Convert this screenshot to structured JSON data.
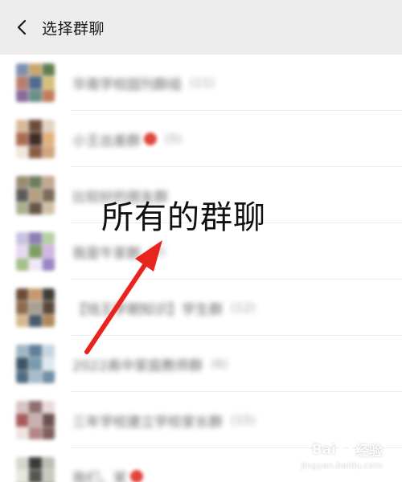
{
  "header": {
    "title": "选择群聊",
    "back_icon": "chevron-left-icon",
    "background": "#ededed"
  },
  "groups": [
    {
      "name": "华南学校园刊群组",
      "count": "(11)",
      "avatar_colors": [
        "#7a8fb0",
        "#c9a66b",
        "#5e7d4f",
        "#b77d6d",
        "#4f6a8c",
        "#d8c07a",
        "#8a6a9c",
        "#6b8f86",
        "#c47c5a"
      ]
    },
    {
      "name": "小王出差群",
      "count": "(5)",
      "emoji": true,
      "avatar_colors": [
        "#d8b99a",
        "#6e4a3a",
        "#e2d2c2",
        "#aa6b50",
        "#3f2c25",
        "#e4b07a",
        "#f0e6dc",
        "#8b5c44",
        "#d1a47c"
      ]
    },
    {
      "name": "比较好的朋友群",
      "count": "",
      "avatar_colors": [
        "#9a8a6e",
        "#6f7d5e",
        "#c2a890",
        "#5a5a58",
        "#b59f7d",
        "#7c6a58",
        "#a9b08e",
        "#665547",
        "#d1c0a8"
      ]
    },
    {
      "name": "我是牛家群",
      "count": "(8)",
      "avatar_colors": [
        "#c9c2e0",
        "#8e7fb5",
        "#b5d0a0",
        "#e6d9f2",
        "#7d9f63",
        "#d3b5e4",
        "#a3bf8a",
        "#f0e8f6",
        "#9a86c7"
      ]
    },
    {
      "name": "【钱王学期知识】学生群",
      "count": "(12)",
      "avatar_colors": [
        "#6a4b36",
        "#c49a6c",
        "#3e3b35",
        "#8c6a4a",
        "#a8a091",
        "#5a4636",
        "#d7b98d",
        "#4a5a6a",
        "#b08a5a"
      ]
    },
    {
      "name": "2022高中家庭教师群",
      "count": "(6)",
      "avatar_colors": [
        "#9fb6c6",
        "#5f7f99",
        "#c6d6e0",
        "#3f5566",
        "#7a9ab1",
        "#dfe8ee",
        "#4d6b82",
        "#a7bccb",
        "#6f8fa8"
      ]
    },
    {
      "name": "三年学校建立学校家长群",
      "count": "(15)",
      "avatar_colors": [
        "#d9c3c3",
        "#8e6d6d",
        "#e8dada",
        "#a85a5a",
        "#c8b0b0",
        "#6d5050",
        "#f0e4e4",
        "#b48686",
        "#7c5e5e"
      ]
    },
    {
      "name": "我们，家",
      "count": "",
      "emoji": true,
      "avatar_colors": [
        "#d6d6cc",
        "#3a3a3a",
        "#bdbdb2",
        "#e8e8e0",
        "#555550",
        "#c9c9be",
        "#a0a098",
        "#ededE6",
        "#6a6a62"
      ]
    }
  ],
  "annotation": {
    "text": "所有的群聊",
    "arrow_color": "#e8241f"
  },
  "watermark": {
    "brand_left": "Bai",
    "brand_right": "经验",
    "paw_icon": "paw-icon",
    "url": "jingyan.baidu.com"
  }
}
